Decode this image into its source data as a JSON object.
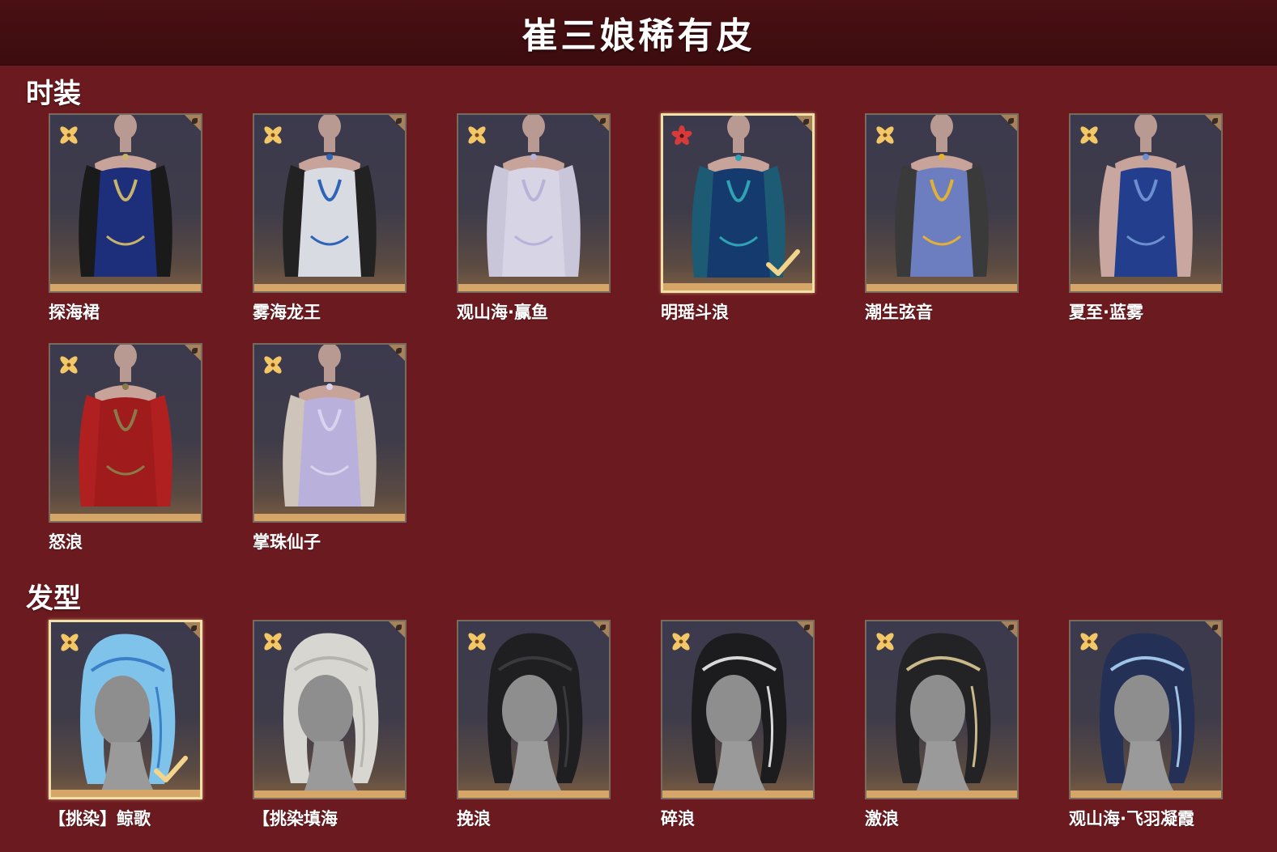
{
  "page": {
    "title": "崔三娘稀有皮"
  },
  "sections": {
    "outfits": {
      "title": "时装",
      "items": [
        {
          "name": "探海裙",
          "rarity": "gold-flower",
          "selected": false,
          "dress": "#1d2f7a",
          "accent": "#c8b36a",
          "sleeve": "#1a1a1a"
        },
        {
          "name": "雾海龙王",
          "rarity": "gold-flower",
          "selected": false,
          "dress": "#d9dbe2",
          "accent": "#2d64b8",
          "sleeve": "#222"
        },
        {
          "name": "观山海·赢鱼",
          "rarity": "gold-flower",
          "selected": false,
          "dress": "#d7d4e6",
          "accent": "#b7b2d8",
          "sleeve": "#c8c6d8"
        },
        {
          "name": "明瑶斗浪",
          "rarity": "red-flower",
          "selected": true,
          "dress": "#153a6e",
          "accent": "#2fa3b4",
          "sleeve": "#1d5b74"
        },
        {
          "name": "潮生弦音",
          "rarity": "gold-flower",
          "selected": false,
          "dress": "#6c7ec0",
          "accent": "#e1b035",
          "sleeve": "#3a3a3a"
        },
        {
          "name": "夏至·蓝雾",
          "rarity": "gold-flower",
          "selected": false,
          "dress": "#233e8c",
          "accent": "#6a8ed1",
          "sleeve": "#c9a7a0"
        },
        {
          "name": "怒浪",
          "rarity": "gold-flower",
          "selected": false,
          "dress": "#a01c1c",
          "accent": "#8a7a4a",
          "sleeve": "#b02020"
        },
        {
          "name": "掌珠仙子",
          "rarity": "gold-flower",
          "selected": false,
          "dress": "#b9b1dc",
          "accent": "#d9d4ee",
          "sleeve": "#cfc4b9"
        }
      ]
    },
    "hair": {
      "title": "发型",
      "items": [
        {
          "name": "【挑染】鲸歌",
          "rarity": "gold-flower",
          "selected": true,
          "hair": "#7fc2ea",
          "accent": "#3a7fc8"
        },
        {
          "name": "【挑染填海",
          "rarity": "gold-flower",
          "selected": false,
          "hair": "#d8d6d0",
          "accent": "#b5b3ae"
        },
        {
          "name": "挽浪",
          "rarity": "gold-flower",
          "selected": false,
          "hair": "#1f1f22",
          "accent": "#3a3a3e"
        },
        {
          "name": "碎浪",
          "rarity": "gold-flower",
          "selected": false,
          "hair": "#1c1c1f",
          "accent": "#d8d8d8"
        },
        {
          "name": "激浪",
          "rarity": "gold-flower",
          "selected": false,
          "hair": "#232225",
          "accent": "#c9b98a"
        },
        {
          "name": "观山海·飞羽凝霞",
          "rarity": "gold-flower",
          "selected": false,
          "hair": "#243056",
          "accent": "#9fc3e6"
        }
      ]
    }
  },
  "colors": {
    "background": "#6b1a1f",
    "header": "#3c0c0f",
    "gold": "#d5a668",
    "gold_flower": "#f3c766",
    "red_flower": "#d63a3a",
    "check": "#f2d48a"
  }
}
